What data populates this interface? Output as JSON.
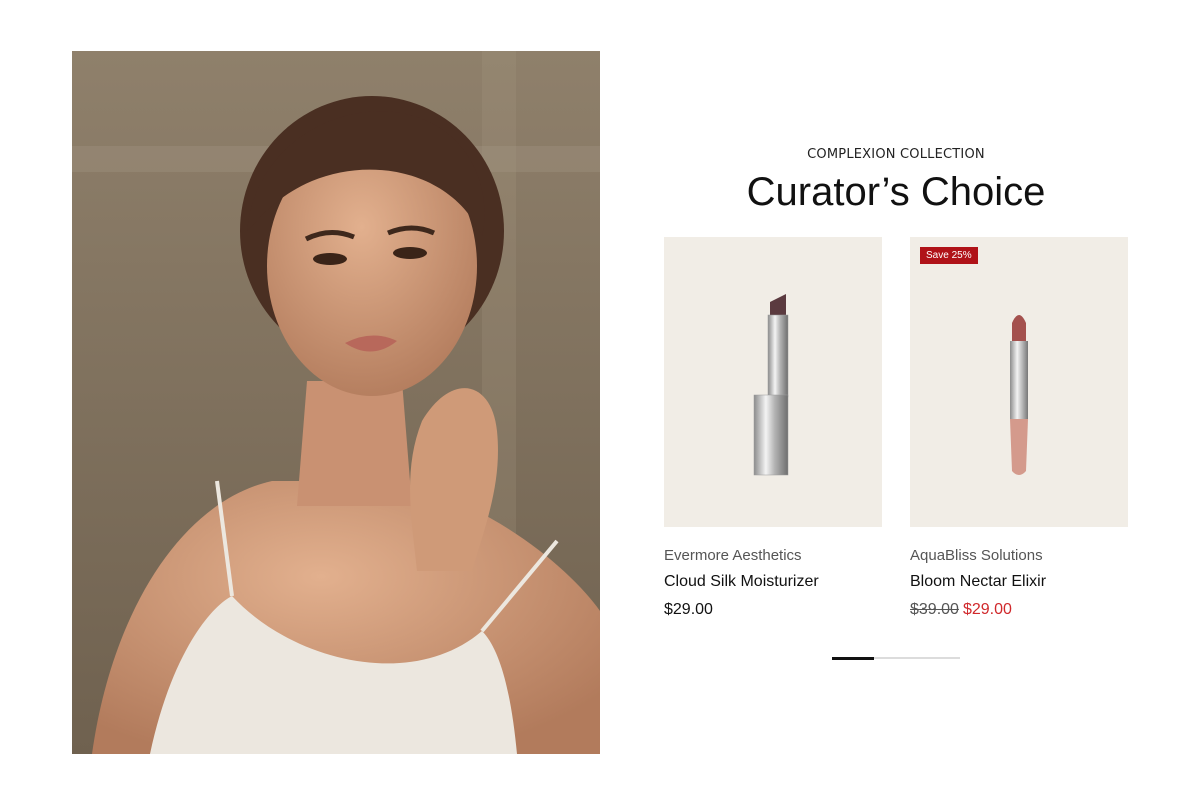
{
  "hero": {
    "alt": "Model portrait"
  },
  "section": {
    "eyebrow": "COMPLEXION COLLECTION",
    "title": "Curator’s Choice"
  },
  "products": [
    {
      "brand": "Evermore Aesthetics",
      "name": "Cloud Silk Moisturizer",
      "price": "$29.00",
      "badge": null
    },
    {
      "brand": "AquaBliss Solutions",
      "name": "Bloom Nectar Elixir",
      "old_price": "$39.00",
      "price": "$29.00",
      "badge": "Save 25%"
    }
  ],
  "carousel": {
    "progress": 0.33
  },
  "colors": {
    "sale": "#d0282b",
    "badge_bg": "#b01218",
    "card_bg": "#f1ede6"
  }
}
